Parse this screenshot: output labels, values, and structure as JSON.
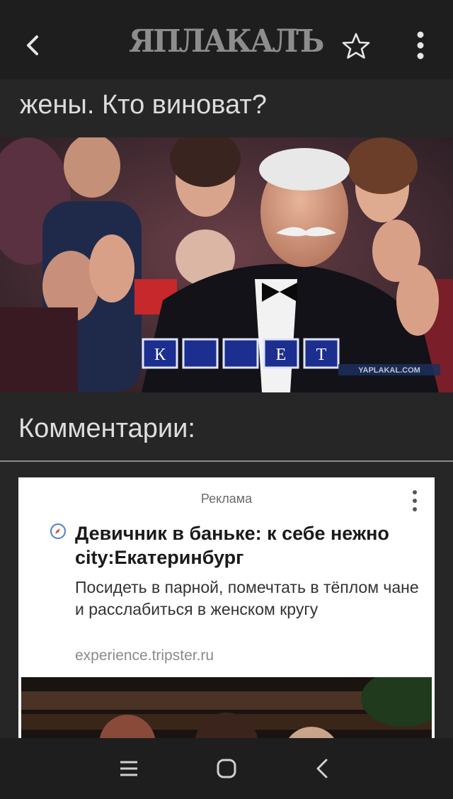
{
  "topbar": {
    "logo_text": "ЯПЛАКАЛЪ",
    "back_icon": "chevron-left-icon",
    "favorite_icon": "star-outline-icon",
    "menu_icon": "more-vertical-icon"
  },
  "article": {
    "title_tail": "жены. Кто виноват?",
    "puzzle_letters": [
      "К",
      "",
      "",
      "Е",
      "Т"
    ],
    "watermark": "YAPLAKAL.COM"
  },
  "comments": {
    "heading": "Комментарии:"
  },
  "ad": {
    "label": "Реклама",
    "title": "Девичник в баньке: к себе нежно city:Екатеринбург",
    "description": "Посидеть в парной, помечтать в тёплом чане и расслабиться в женском кругу",
    "url": "experience.tripster.ru"
  },
  "navbar": {
    "recent_icon": "recent-apps-icon",
    "home_icon": "home-icon",
    "back_icon": "back-icon"
  },
  "colors": {
    "background": "#262626",
    "topbar": "#1e1e1e",
    "text": "#dcdcdc",
    "ad_background": "#ffffff"
  }
}
